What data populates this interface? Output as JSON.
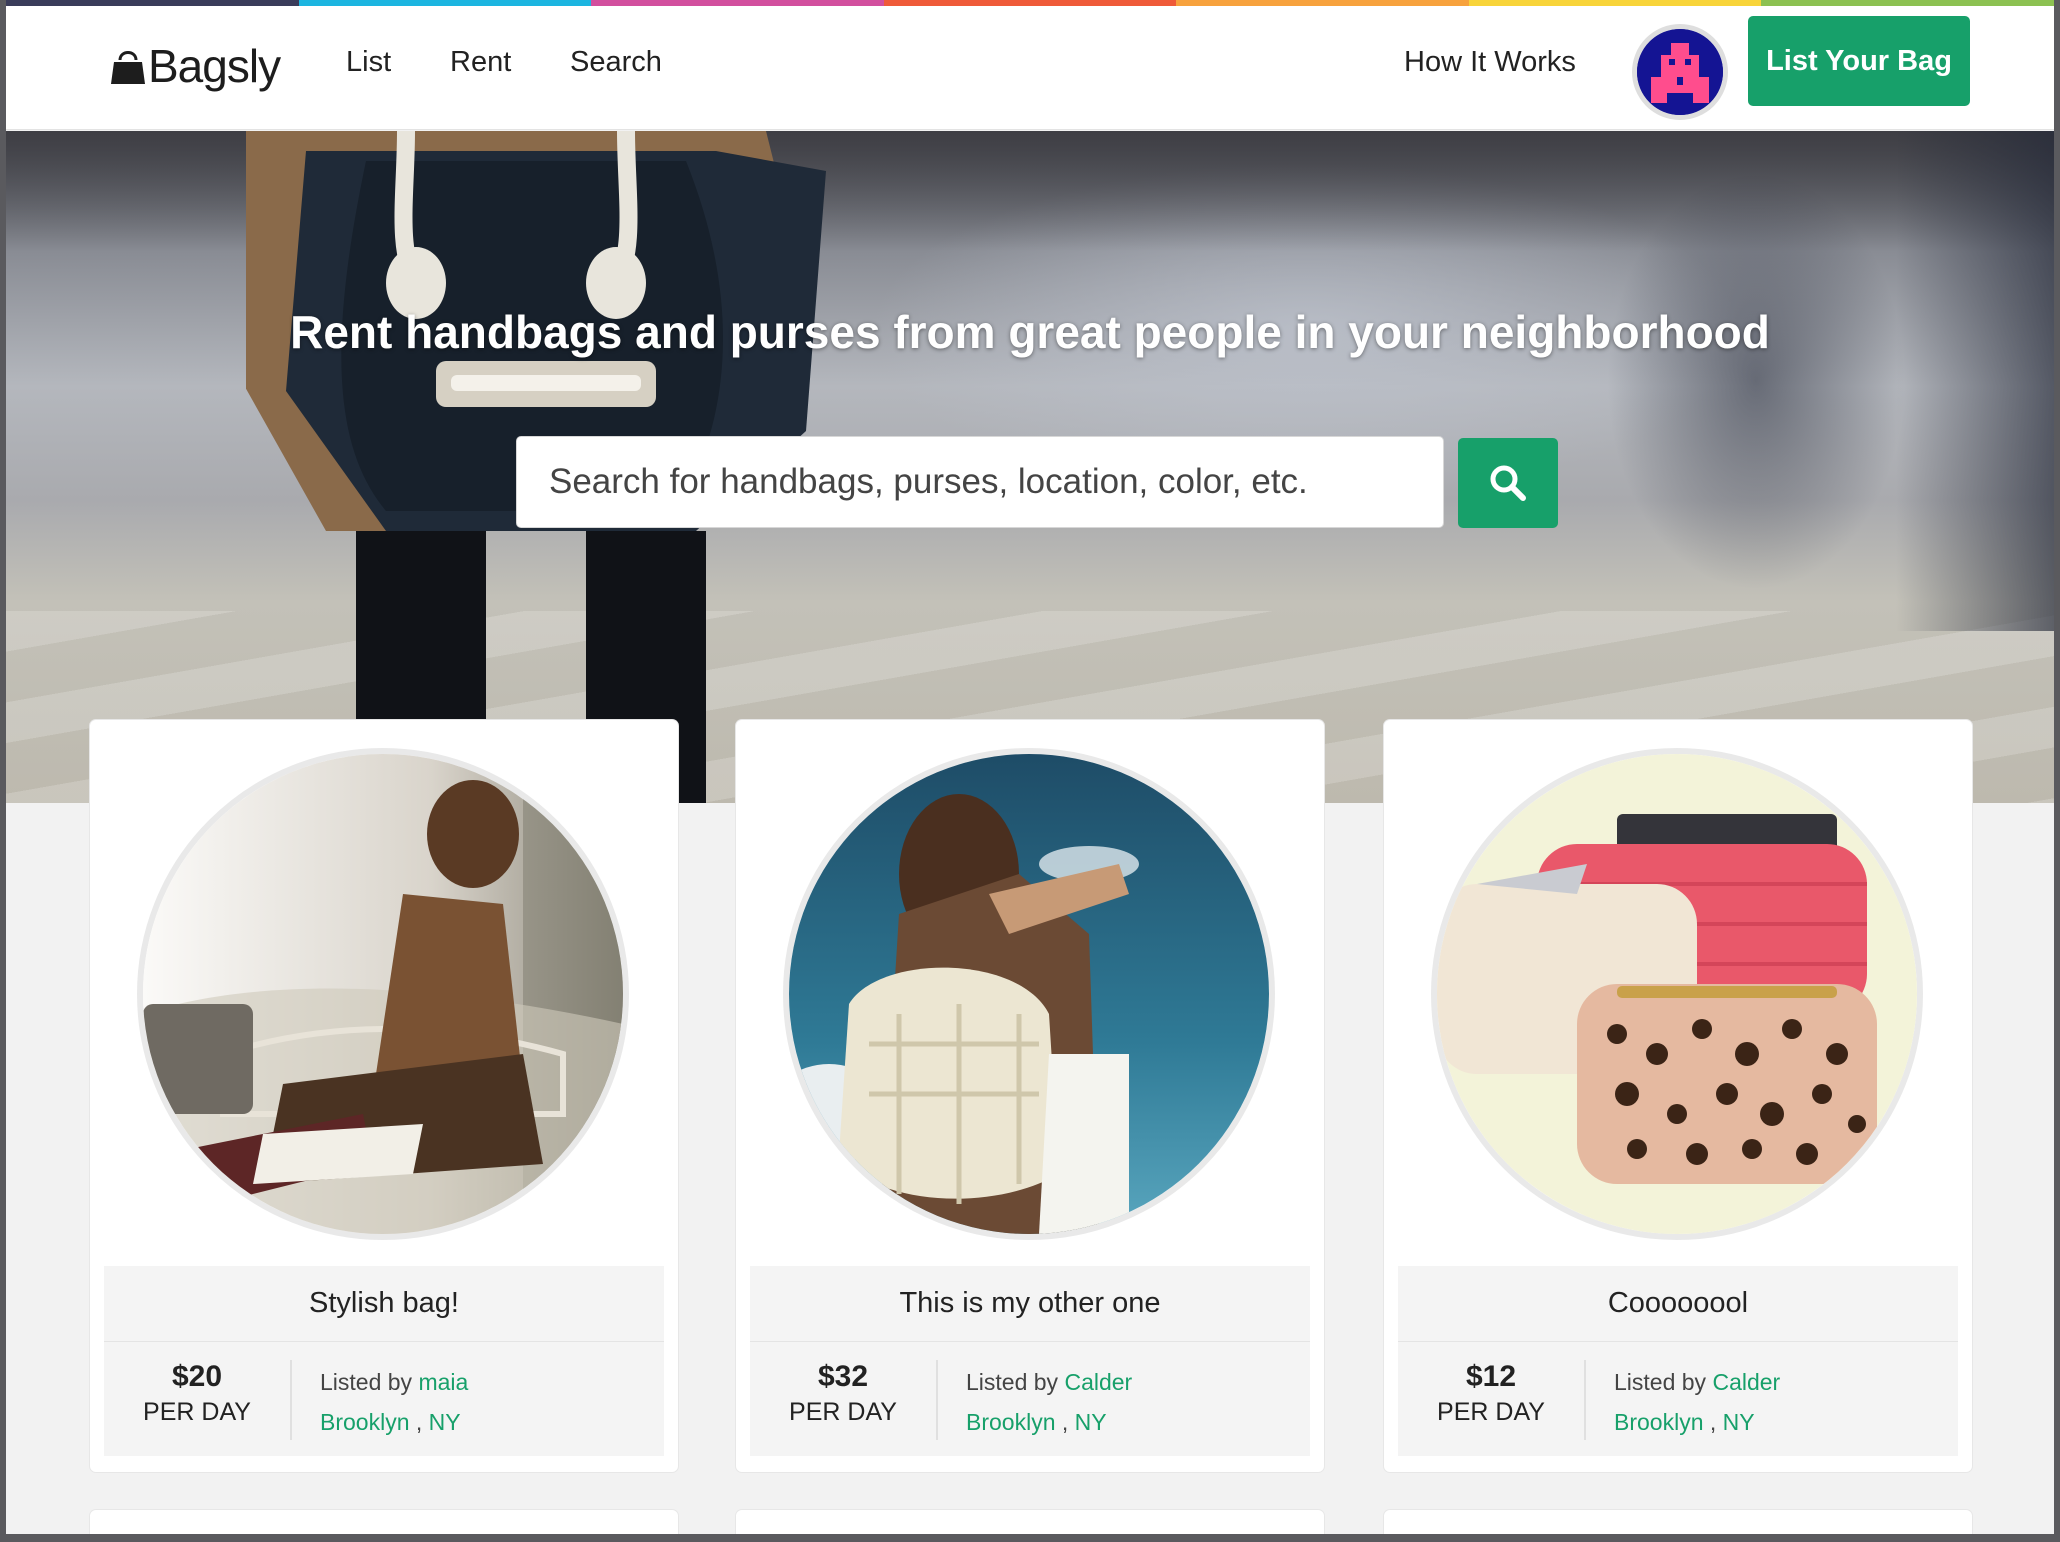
{
  "brand": {
    "name": "Bagsly"
  },
  "nav": {
    "list": "List",
    "rent": "Rent",
    "search": "Search",
    "how_it_works": "How It Works",
    "cta": "List Your Bag"
  },
  "hero": {
    "headline": "Rent handbags and purses from great people in your neighborhood",
    "search_placeholder": "Search for handbags, purses, location, color, etc."
  },
  "colors": {
    "accent": "#17a06a",
    "stripe": [
      "#3a3c5a",
      "#1cb5e0",
      "#d24f9e",
      "#ef5a39",
      "#f7a23d",
      "#f8d43a",
      "#8cc152"
    ]
  },
  "listings": [
    {
      "title": "Stylish bag!",
      "price": "$20",
      "per": "PER DAY",
      "listed_by": "Listed by",
      "owner": "maia",
      "city": "Brooklyn",
      "sep": " , ",
      "state": "NY"
    },
    {
      "title": "This is my other one",
      "price": "$32",
      "per": "PER DAY",
      "listed_by": "Listed by",
      "owner": "Calder",
      "city": "Brooklyn",
      "sep": " , ",
      "state": "NY"
    },
    {
      "title": "Coooooool",
      "price": "$12",
      "per": "PER DAY",
      "listed_by": "Listed by",
      "owner": "Calder",
      "city": "Brooklyn",
      "sep": " , ",
      "state": "NY"
    }
  ]
}
